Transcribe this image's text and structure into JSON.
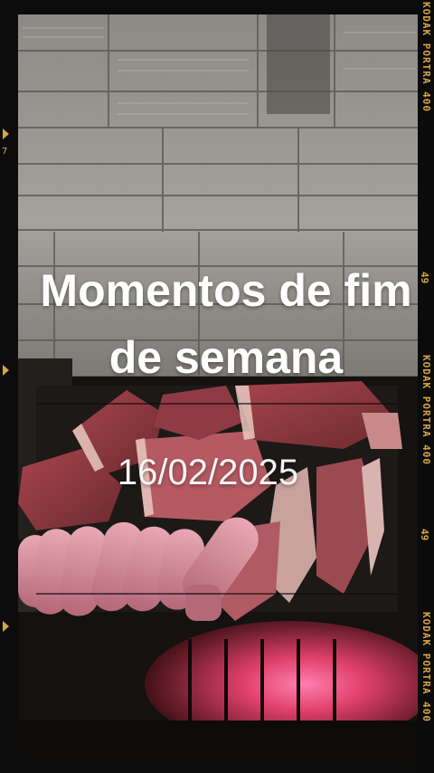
{
  "overlay": {
    "title": "Momentos de fim de semana",
    "date": "16/02/2025"
  },
  "film_border": {
    "brand": "KODAK",
    "stock": "PORTRA 400",
    "frame_number": "49",
    "left_number": "7",
    "accent_color": "#d9a441"
  },
  "photo": {
    "subject": "grilled meats and sausages on a barbecue grill over glowing coals, cinder-block wall behind"
  }
}
